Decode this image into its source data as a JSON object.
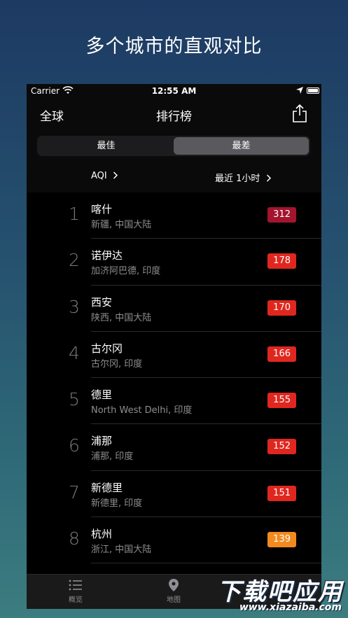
{
  "headline": "多个城市的直观对比",
  "status": {
    "carrier": "Carrier",
    "time": "12:55 AM"
  },
  "nav": {
    "left": "全球",
    "title": "排行榜",
    "share_icon": "share-icon"
  },
  "segment": {
    "options": [
      "最佳",
      "最差"
    ],
    "selected": "最差"
  },
  "filters": {
    "metric": "AQI",
    "period": "最近 1小时"
  },
  "rankings": [
    {
      "rank": "1",
      "city": "喀什",
      "region": "新疆, 中国大陆",
      "aqi": "312",
      "color": "#a3142e"
    },
    {
      "rank": "2",
      "city": "诺伊达",
      "region": "加济阿巴德, 印度",
      "aqi": "178",
      "color": "#e0271f"
    },
    {
      "rank": "3",
      "city": "西安",
      "region": "陕西, 中国大陆",
      "aqi": "170",
      "color": "#e0271f"
    },
    {
      "rank": "4",
      "city": "古尔冈",
      "region": "古尔冈, 印度",
      "aqi": "166",
      "color": "#e0271f"
    },
    {
      "rank": "5",
      "city": "德里",
      "region": "North West Delhi, 印度",
      "aqi": "155",
      "color": "#e0271f"
    },
    {
      "rank": "6",
      "city": "浦那",
      "region": "浦那, 印度",
      "aqi": "152",
      "color": "#e0271f"
    },
    {
      "rank": "7",
      "city": "新德里",
      "region": "新德里, 印度",
      "aqi": "151",
      "color": "#e0271f"
    },
    {
      "rank": "8",
      "city": "杭州",
      "region": "浙江, 中国大陆",
      "aqi": "139",
      "color": "#f28a1f"
    }
  ],
  "tabs": [
    {
      "label": "概览",
      "icon": "list-icon"
    },
    {
      "label": "地图",
      "icon": "map-pin-icon"
    }
  ],
  "watermark": {
    "big": "下载吧应用",
    "small": "www.xiazaiba.com"
  }
}
